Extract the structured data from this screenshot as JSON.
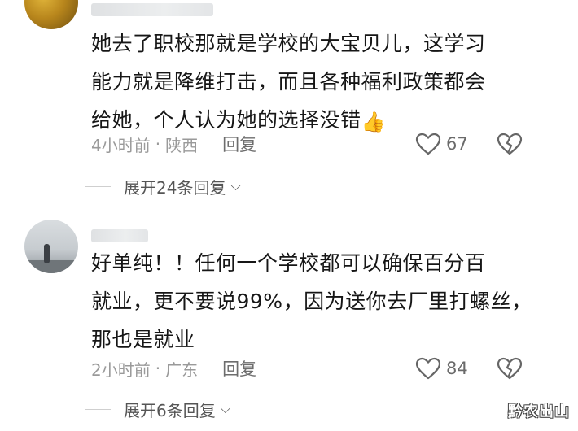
{
  "comments": [
    {
      "username": "••••••••",
      "text_lines": [
        "她去了职校那就是学校的大宝贝儿，这学习",
        "能力就是降维打击，而且各种福利政策都会",
        "给她，个人认为她的选择没错"
      ],
      "emoji": "👍",
      "time": "4小时前",
      "separator": "·",
      "location": "陕西",
      "reply_label": "回复",
      "likes": "67",
      "expand_label": "展开24条回复"
    },
    {
      "username": "••••",
      "text_lines": [
        "好单纯！！任何一个学校都可以确保百分百",
        "就业，更不要说99%，因为送你去厂里打螺丝，",
        "那也是就业"
      ],
      "time": "2小时前",
      "separator": "·",
      "location": "广东",
      "reply_label": "回复",
      "likes": "84",
      "expand_label": "展开6条回复"
    }
  ],
  "icons": {
    "like": "heart-outline-icon",
    "dislike": "broken-heart-icon",
    "expand": "chevron-down-icon"
  },
  "watermark": "黔农出山",
  "colors": {
    "meta_gray": "#9a9a9a",
    "text": "#161616",
    "emoji_accent": "#e8a318"
  }
}
